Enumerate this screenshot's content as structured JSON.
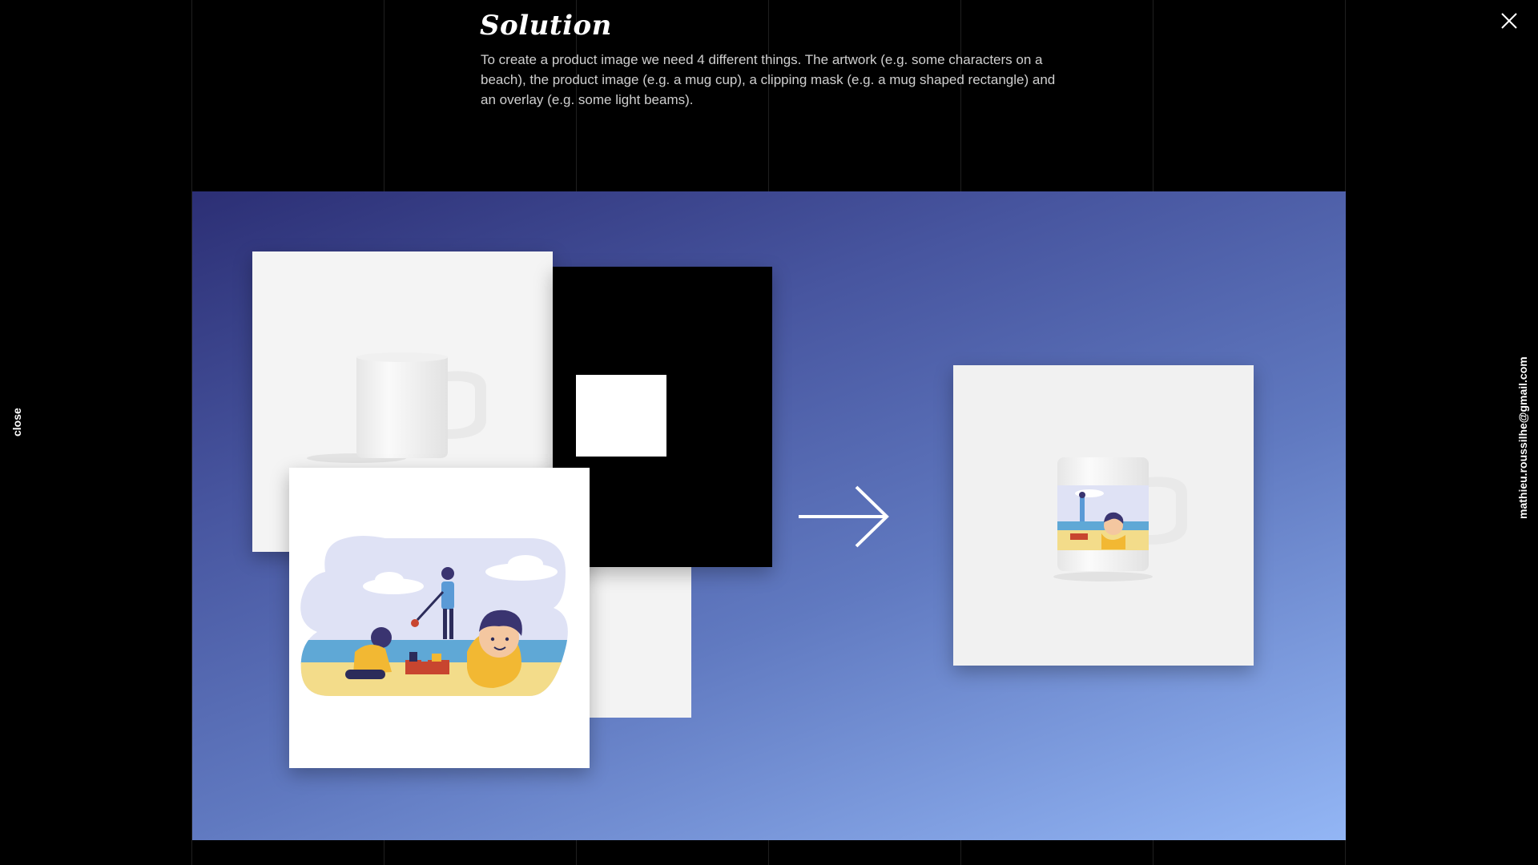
{
  "header": {
    "title": "Solution",
    "description": "To create a product image we need 4 different things. The artwork (e.g. some characters on a beach), the product image (e.g. a mug cup), a clipping mask (e.g. a mug shaped rectangle) and an overlay (e.g. some light beams)."
  },
  "controls": {
    "close_label": "close",
    "email": "mathieu.roussilhe@gmail.com"
  },
  "colors": {
    "background": "#000000",
    "panel_gradient_start": "#2c2f75",
    "panel_gradient_end": "#93b6f5",
    "accent_white": "#ffffff"
  },
  "icons": {
    "close": "close-icon",
    "arrow": "arrow-right-icon"
  }
}
